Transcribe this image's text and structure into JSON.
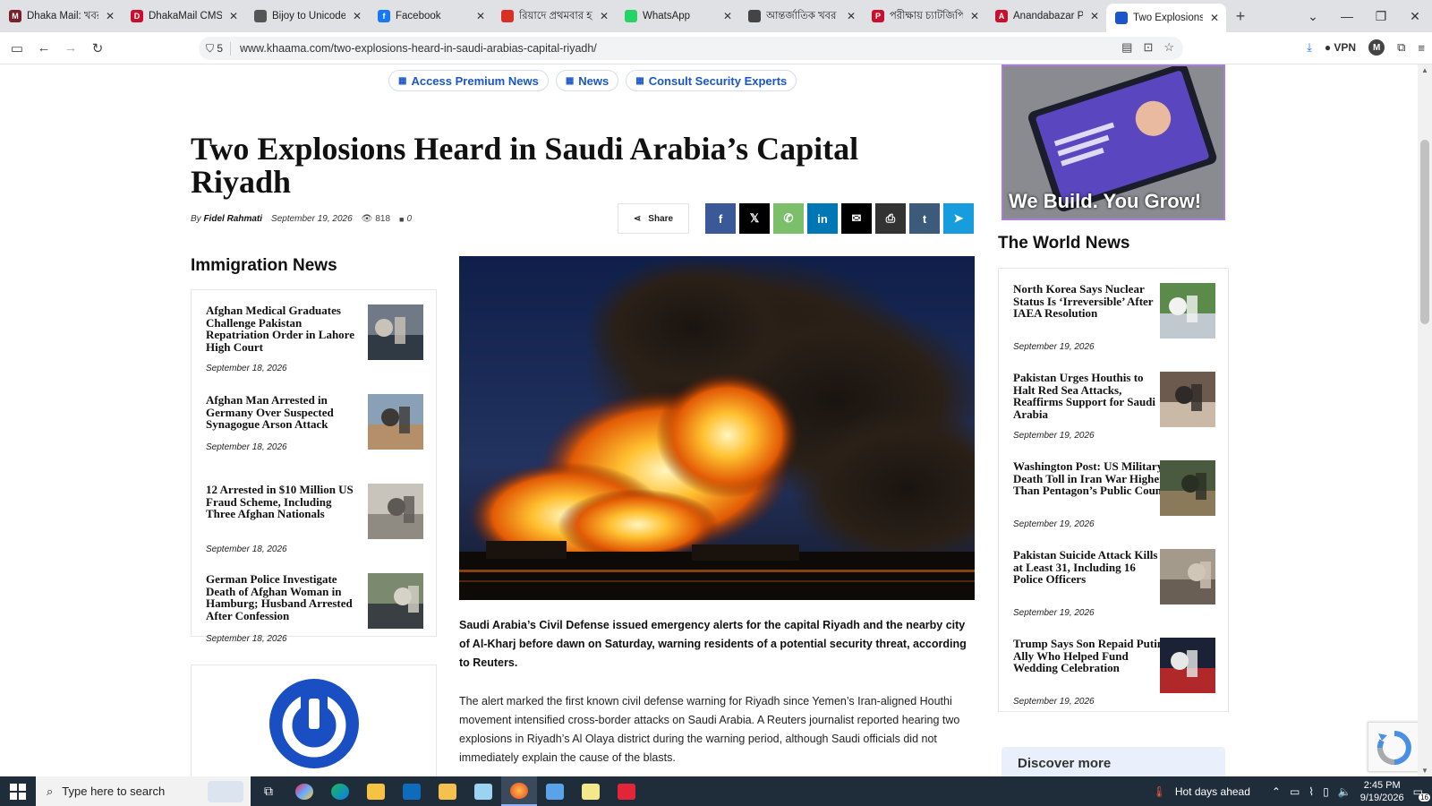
{
  "browser": {
    "tabs": [
      {
        "title": "Dhaka Mail: খবর, সব",
        "fav_color": "#7b1f2b",
        "fav_letter": "M",
        "width": 136
      },
      {
        "title": "DhakaMail CMS",
        "fav_color": "#c8102e",
        "fav_letter": "D",
        "width": 138
      },
      {
        "title": "Bijoy to Unicode with",
        "fav_color": "#555555",
        "fav_letter": "",
        "width": 138
      },
      {
        "title": "Facebook",
        "fav_color": "#1877f2",
        "fav_letter": "f",
        "width": 138
      },
      {
        "title": "রিয়াদে প্রথমবার হামলা",
        "fav_color": "#d93025",
        "fav_letter": "",
        "width": 138
      },
      {
        "title": "WhatsApp",
        "fav_color": "#25d366",
        "fav_letter": "",
        "width": 138
      },
      {
        "title": "আন্তর্জাতিক খবর - বি",
        "fav_color": "#444444",
        "fav_letter": "",
        "width": 138
      },
      {
        "title": "পরীক্ষায় চ্যাটজিপিটি",
        "fav_color": "#c8102e",
        "fav_letter": "P",
        "width": 138
      },
      {
        "title": "Anandabazar Patrika",
        "fav_color": "#c8102e",
        "fav_letter": "A",
        "width": 134
      },
      {
        "title": "Two Explosions Heard",
        "fav_color": "#1a56c9",
        "fav_letter": "",
        "width": 134,
        "active": true
      }
    ],
    "url": "www.khaama.com/two-explosions-heard-in-saudi-arabias-capital-riyadh/",
    "shield_count": "5",
    "vpn_label": "VPN",
    "profile_letter": "M"
  },
  "nav_pills": [
    {
      "label": "Access Premium News"
    },
    {
      "label": "News"
    },
    {
      "label": "Consult Security Experts"
    }
  ],
  "article": {
    "headline": "Two Explosions Heard in Saudi Arabia’s Capital Riyadh",
    "by": "By",
    "author": "Fidel Rahmati",
    "date": "September 19, 2026",
    "views": "818",
    "comments": "0",
    "share_label": "Share",
    "lead": "Saudi Arabia’s Civil Defense issued emergency alerts for the capital Riyadh and the nearby city of Al-Kharj before dawn on Saturday, warning residents of a potential security threat, according to Reuters.",
    "paragraph": "The alert marked the first known civil defense warning for Riyadh since Yemen’s Iran-aligned Houthi movement intensified cross-border attacks on Saudi Arabia. A Reuters journalist reported hearing two explosions in Riyadh’s Al Olaya district during the warning period, although Saudi officials did not immediately explain the cause of the blasts."
  },
  "share_buttons": [
    {
      "name": "facebook",
      "glyph": "f",
      "color": "#3b5998"
    },
    {
      "name": "x",
      "glyph": "𝕏",
      "color": "#000000"
    },
    {
      "name": "whatsapp",
      "glyph": "✆",
      "color": "#7bbf6a"
    },
    {
      "name": "linkedin",
      "glyph": "in",
      "color": "#0077b5"
    },
    {
      "name": "email",
      "glyph": "✉",
      "color": "#000000"
    },
    {
      "name": "print",
      "glyph": "⎙",
      "color": "#333333"
    },
    {
      "name": "tumblr",
      "glyph": "t",
      "color": "#3c5a7a"
    },
    {
      "name": "telegram",
      "glyph": "➤",
      "color": "#179cde"
    }
  ],
  "immigration": {
    "title": "Immigration News",
    "items": [
      {
        "title": "Afghan Medical Graduates Challenge Pakistan Repatriation Order in Lahore High Court",
        "date": "September 18, 2026"
      },
      {
        "title": "Afghan Man Arrested in Germany Over Suspected Synagogue Arson Attack",
        "date": "September 18, 2026"
      },
      {
        "title": "12 Arrested in $10 Million US Fraud Scheme, Including Three Afghan Nationals",
        "date": "September 18, 2026"
      },
      {
        "title": "German Police Investigate Death of Afghan Woman in Hamburg; Husband Arrested After Confession",
        "date": "September 18, 2026"
      }
    ]
  },
  "world": {
    "title": "The World News",
    "items": [
      {
        "title": "North Korea Says Nuclear Status Is ‘Irreversible’ After IAEA Resolution",
        "date": "September 19, 2026"
      },
      {
        "title": "Pakistan Urges Houthis to Halt Red Sea Attacks, Reaffirms Support for Saudi Arabia",
        "date": "September 19, 2026"
      },
      {
        "title": "Washington Post: US Military Death Toll in Iran War Higher Than Pentagon’s Public Count",
        "date": "September 19, 2026"
      },
      {
        "title": "Pakistan Suicide Attack Kills at Least 31, Including 16 Police Officers",
        "date": "September 19, 2026"
      },
      {
        "title": "Trump Says Son Repaid Putin Ally Who Helped Fund Wedding Celebration",
        "date": "September 19, 2026"
      }
    ]
  },
  "ad": {
    "tagline": "We Build. You Grow!"
  },
  "discover": {
    "label": "Discover more"
  },
  "taskbar": {
    "search_placeholder": "Type here to search",
    "weather": "Hot days ahead",
    "time": "2:45 PM",
    "date": "9/19/2026",
    "notif_count": "16"
  }
}
